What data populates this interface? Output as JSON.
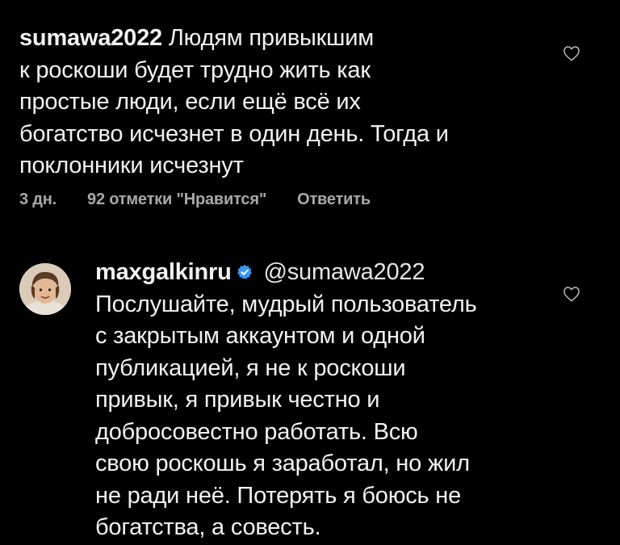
{
  "comments": [
    {
      "username": "sumawa2022",
      "text": "Людям привыкшим\nк роскоши будет трудно жить как\nпростые люди, если ещё всё их\nбогатство исчезнет в один день. Тогда и\nпоклонники исчезнут",
      "time": "3 дн.",
      "likes": "92 отметки \"Нравится\"",
      "reply_label": "Ответить",
      "like_icon": "heart-outline-icon"
    },
    {
      "username": "maxgalkinru",
      "verified_icon": "verified-badge-icon",
      "mention": "@sumawa2022",
      "text": "Послушайте, мудрый пользователь\nс закрытым аккаунтом и одной\nпубликацией, я не к роскоши\nпривык, я привык честно и\nдобросовестно работать. Всю\nсвою роскошь я заработал, но жил\nне ради неё. Потерять я боюсь не\nбогатства, а совесть.",
      "like_icon": "heart-outline-icon",
      "avatar": "user-avatar"
    }
  ],
  "colors": {
    "background": "#000000",
    "text": "#f2f2f2",
    "meta": "#a8a8a8",
    "verified": "#3897f0"
  }
}
